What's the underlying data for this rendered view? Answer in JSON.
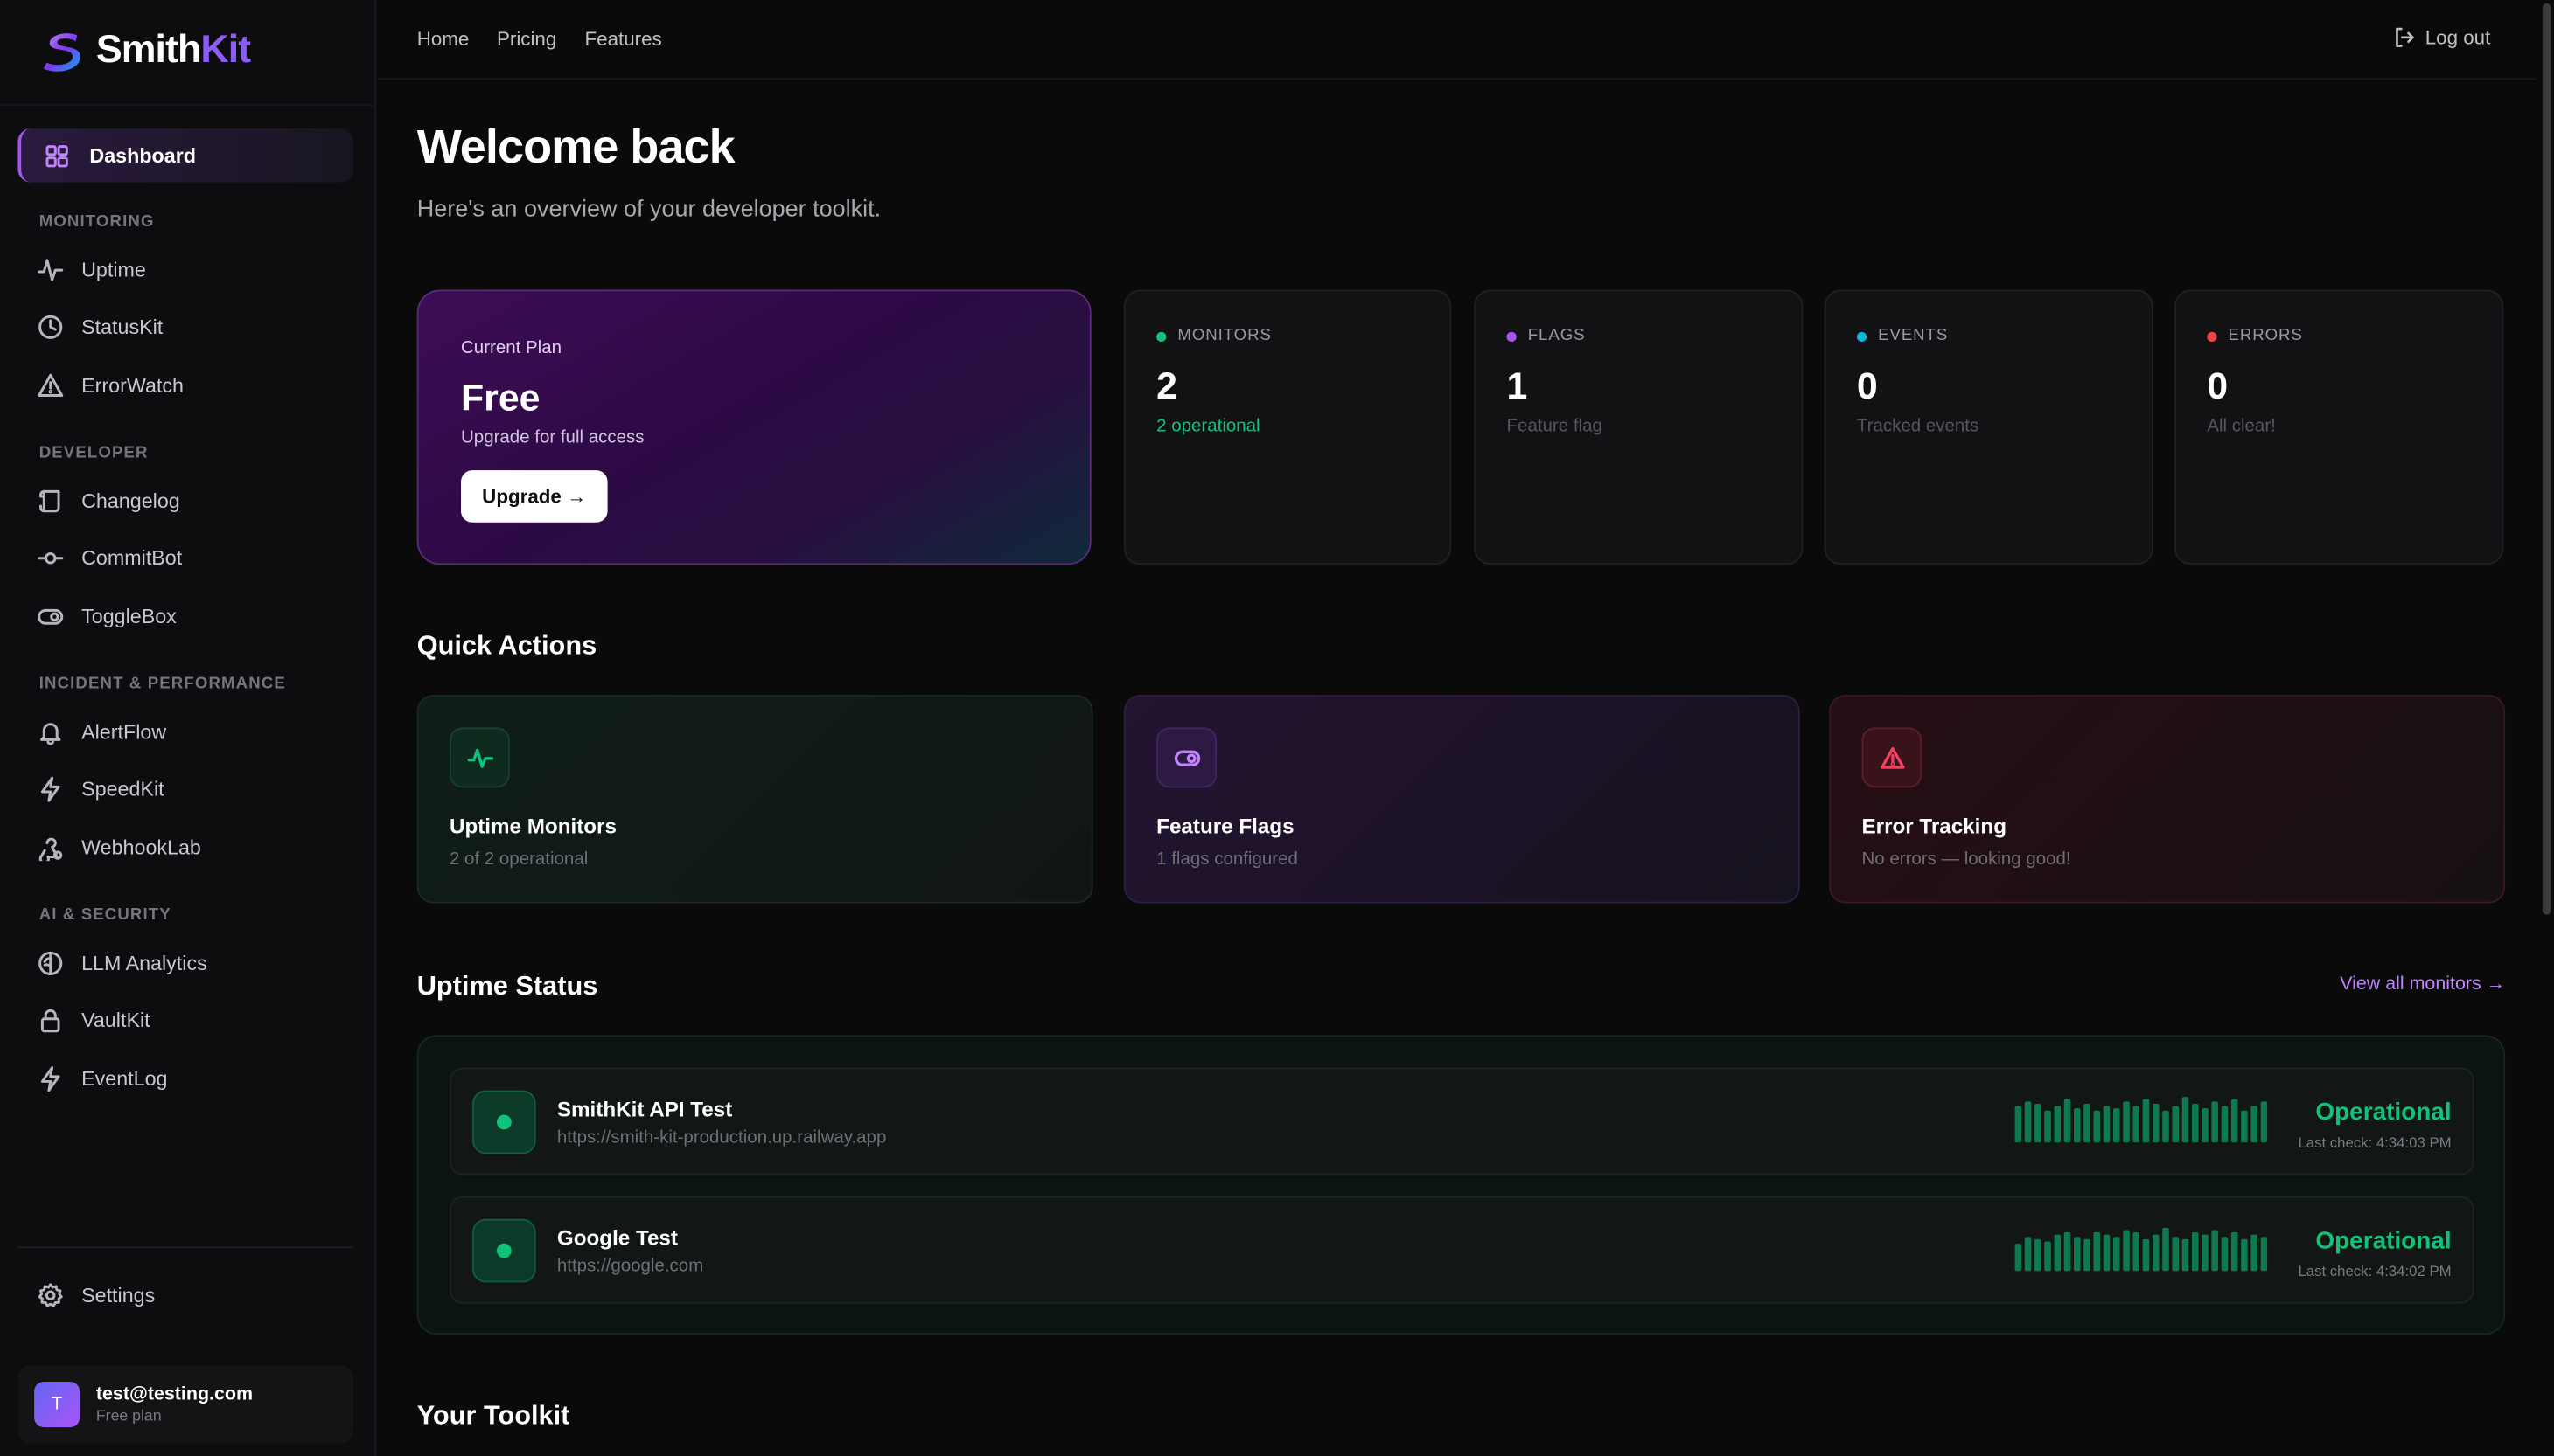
{
  "brand": {
    "name_a": "Smith",
    "name_b": "Kit"
  },
  "topnav": {
    "home": "Home",
    "pricing": "Pricing",
    "features": "Features",
    "logout": "Log out"
  },
  "sidebar": {
    "dashboard": "Dashboard",
    "sections": {
      "monitoring": "MONITORING",
      "developer": "DEVELOPER",
      "incident": "INCIDENT & PERFORMANCE",
      "ai_security": "AI & SECURITY"
    },
    "items": {
      "uptime": "Uptime",
      "statuskit": "StatusKit",
      "errorwatch": "ErrorWatch",
      "changelog": "Changelog",
      "commitbot": "CommitBot",
      "togglebox": "ToggleBox",
      "alertflow": "AlertFlow",
      "speedkit": "SpeedKit",
      "webhooklab": "WebhookLab",
      "llm_analytics": "LLM Analytics",
      "vaultkit": "VaultKit",
      "eventlog": "EventLog"
    },
    "settings": "Settings",
    "user": {
      "initial": "T",
      "email": "test@testing.com",
      "plan": "Free plan"
    }
  },
  "main": {
    "title": "Welcome back",
    "subtitle": "Here's an overview of your developer toolkit.",
    "plan": {
      "label": "Current Plan",
      "name": "Free",
      "desc": "Upgrade for full access",
      "button": "Upgrade →"
    },
    "stats": {
      "monitors": {
        "label": "MONITORS",
        "value": "2",
        "sub": "2 operational",
        "color": "#10c27a"
      },
      "flags": {
        "label": "FLAGS",
        "value": "1",
        "sub": "Feature flag",
        "color": "#a855f7"
      },
      "events": {
        "label": "EVENTS",
        "value": "0",
        "sub": "Tracked events",
        "color": "#06b6d4"
      },
      "errors": {
        "label": "ERRORS",
        "value": "0",
        "sub": "All clear!",
        "color": "#ef4444"
      }
    },
    "quick_actions": {
      "heading": "Quick Actions",
      "uptime": {
        "title": "Uptime Monitors",
        "sub": "2 of 2 operational"
      },
      "flags": {
        "title": "Feature Flags",
        "sub": "1 flags configured"
      },
      "errors": {
        "title": "Error Tracking",
        "sub": "No errors — looking good!"
      }
    },
    "uptime_status": {
      "heading": "Uptime Status",
      "view_all": "View all monitors →",
      "monitors": [
        {
          "name": "SmithKit API Test",
          "url": "https://smith-kit-production.up.railway.app",
          "status": "Operational",
          "last_check": "Last check: 4:34:03 PM",
          "history": [
            0.8,
            0.9,
            0.85,
            0.7,
            0.8,
            0.95,
            0.75,
            0.85,
            0.7,
            0.8,
            0.75,
            0.9,
            0.8,
            0.95,
            0.85,
            0.7,
            0.8,
            1.0,
            0.85,
            0.75,
            0.9,
            0.8,
            0.95,
            0.7,
            0.8,
            0.9
          ]
        },
        {
          "name": "Google Test",
          "url": "https://google.com",
          "status": "Operational",
          "last_check": "Last check: 4:34:02 PM",
          "history": [
            0.6,
            0.75,
            0.7,
            0.65,
            0.8,
            0.85,
            0.75,
            0.7,
            0.85,
            0.8,
            0.75,
            0.9,
            0.85,
            0.7,
            0.8,
            0.95,
            0.75,
            0.7,
            0.85,
            0.8,
            0.9,
            0.75,
            0.85,
            0.7,
            0.8,
            0.75
          ]
        }
      ]
    },
    "toolkit_heading": "Your Toolkit"
  }
}
